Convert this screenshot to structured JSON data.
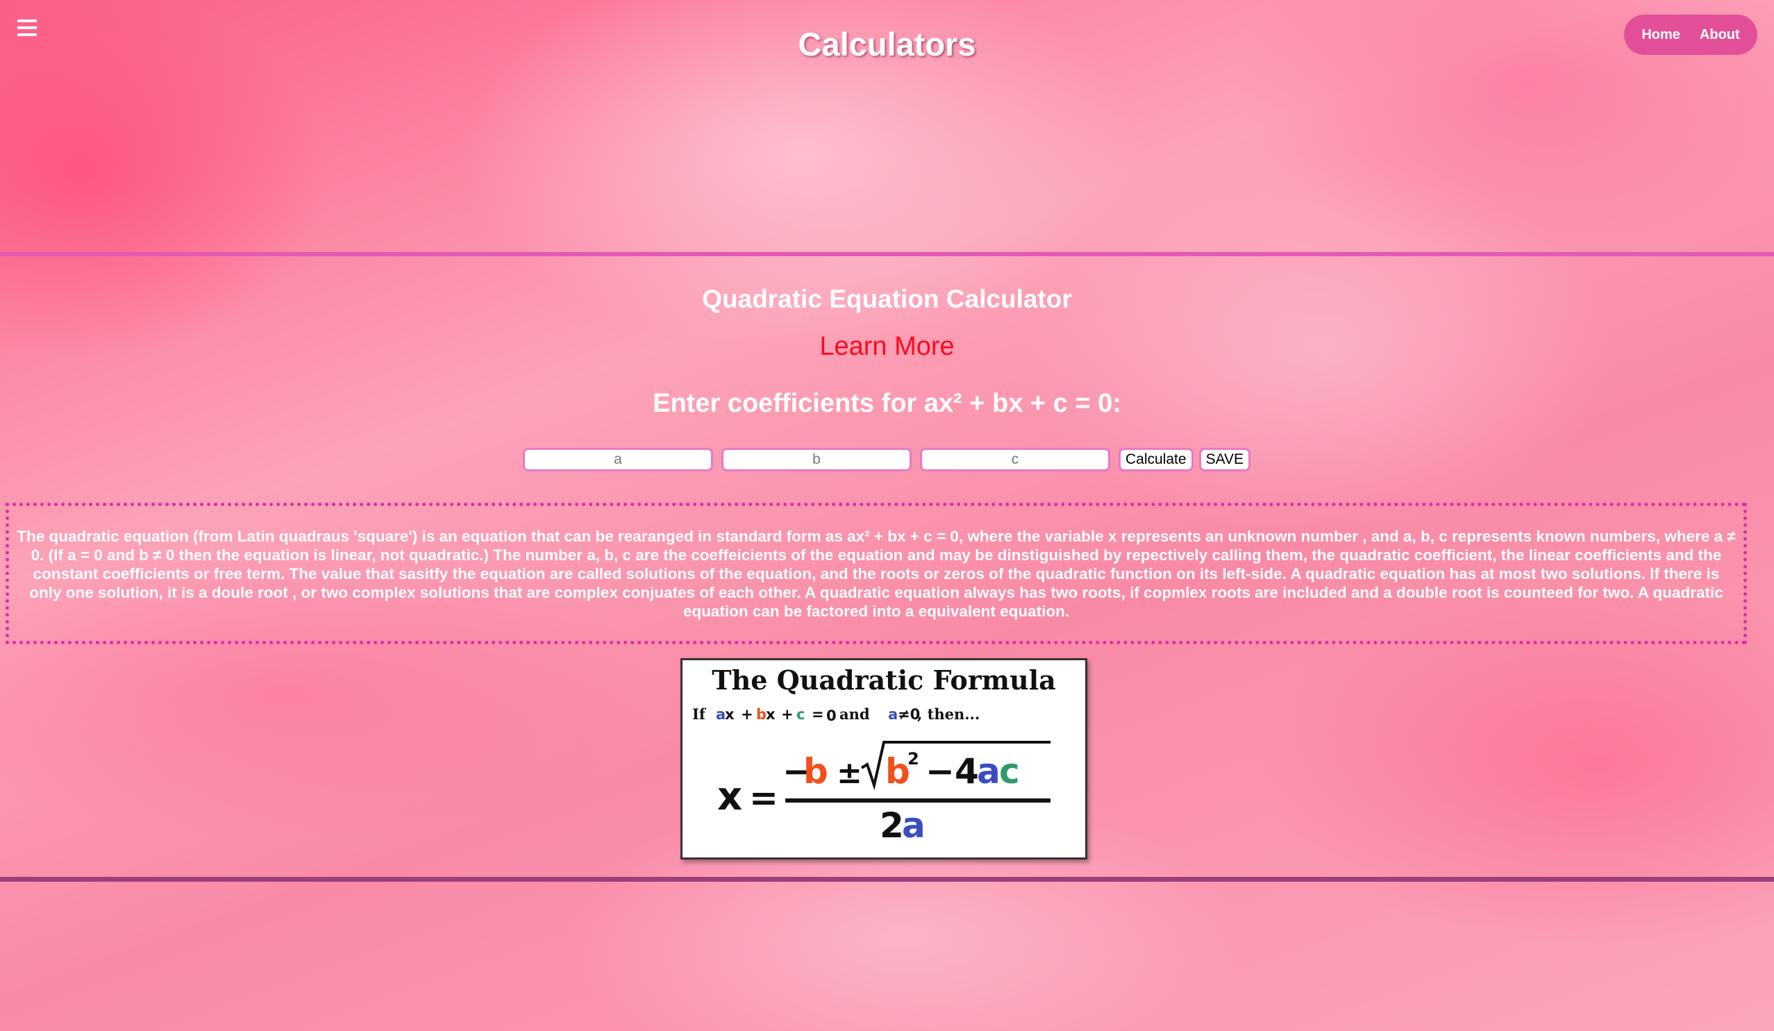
{
  "header": {
    "title": "Calculators",
    "nav": [
      {
        "label": "Home"
      },
      {
        "label": "About"
      }
    ]
  },
  "main": {
    "calculator_title": "Quadratic Equation Calculator",
    "learn_more": "Learn More",
    "prompt": "Enter coefficients for ax² + bx + c = 0:",
    "inputs": {
      "a_placeholder": "a",
      "b_placeholder": "b",
      "c_placeholder": "c",
      "a_value": "",
      "b_value": "",
      "c_value": ""
    },
    "buttons": {
      "calculate": "Calculate",
      "save": "SAVE"
    },
    "description": "The quadratic equation (from Latin quadraus 'square') is an equation that can be rearanged in standard form as ax² + bx + c = 0, where the variable x represents an unknown number , and a, b, c represents known numbers, where a ≠ 0. (If a = 0 and b ≠ 0 then the equation is linear, not quadratic.) The number a, b, c are the coeffeicients of the equation and may be dinstiguished by repectively calling them, the quadratic coefficient, the linear coefficients and the constant coefficients or free term. The value that sasitfy the equation are called solutions of the equation, and the roots or zeros of the quadratic function on its left-side. A quadratic equation has at most two solutions. If there is only one solution, it is a doule root , or two complex solutions that are complex conjuates of each other. A quadratic equation always has two roots, if copmlex roots are included and a double root is counteed for two. A quadratic equation can be factored into a equivalent equation.",
    "formula_image": {
      "heading": "The Quadratic Formula",
      "condition_if": "If",
      "condition_and": "and",
      "condition_then": ", then...",
      "symbols": {
        "a": "a",
        "b": "b",
        "c": "c",
        "x": "x",
        "plus": "+",
        "eq": "=",
        "zero": "0",
        "neq": "≠0",
        "pm": "±",
        "minus": "−",
        "four": "4",
        "two": "2",
        "sq": "2"
      },
      "colors": {
        "a": "#3b4cc0",
        "b": "#f0501e",
        "c": "#2e9b6a",
        "text": "#111111"
      }
    }
  },
  "colors": {
    "nav_bg": "#e24f98",
    "divider_top": "#e25ab3",
    "divider_bottom": "#9b3f7c",
    "learn_more": "#ff0a1e",
    "info_border": "#e02aa9"
  }
}
